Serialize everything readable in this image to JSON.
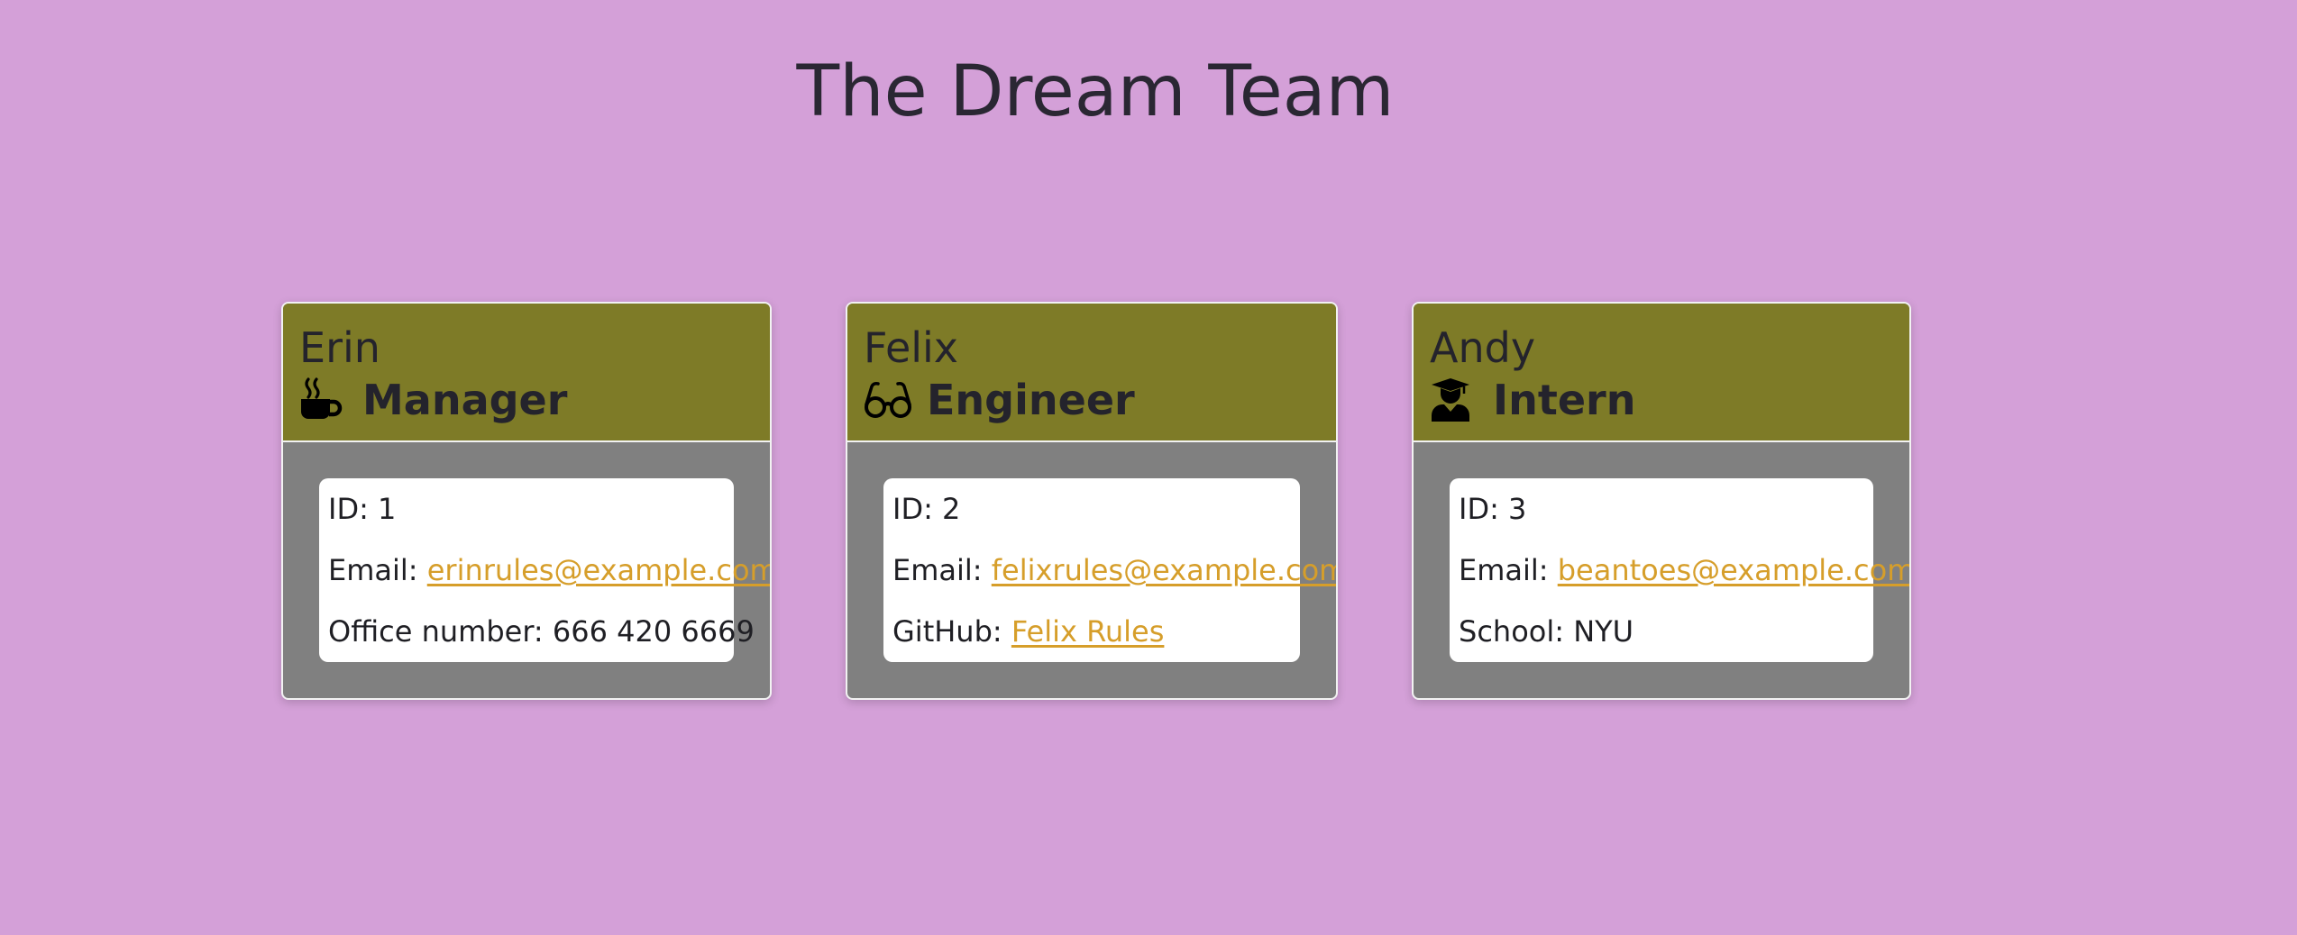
{
  "page": {
    "title": "The Dream Team"
  },
  "colors": {
    "background": "#d4a0d8",
    "card_header": "#7e7b27",
    "card_body_frame": "#808080",
    "link": "#d69e2a"
  },
  "team": [
    {
      "name": "Erin",
      "role": "Manager",
      "icon": "coffee-mug-icon",
      "id_label": "ID:",
      "id": "1",
      "email_label": "Email:",
      "email": "erinrules@example.com",
      "extra_label": "Office number:",
      "extra_value": "666 420 6669"
    },
    {
      "name": "Felix",
      "role": "Engineer",
      "icon": "glasses-icon",
      "id_label": "ID:",
      "id": "2",
      "email_label": "Email:",
      "email": "felixrules@example.com",
      "extra_label": "GitHub:",
      "extra_value": "Felix Rules"
    },
    {
      "name": "Andy",
      "role": "Intern",
      "icon": "graduate-icon",
      "id_label": "ID:",
      "id": "3",
      "email_label": "Email:",
      "email": "beantoes@example.com",
      "extra_label": "School:",
      "extra_value": "NYU"
    }
  ]
}
